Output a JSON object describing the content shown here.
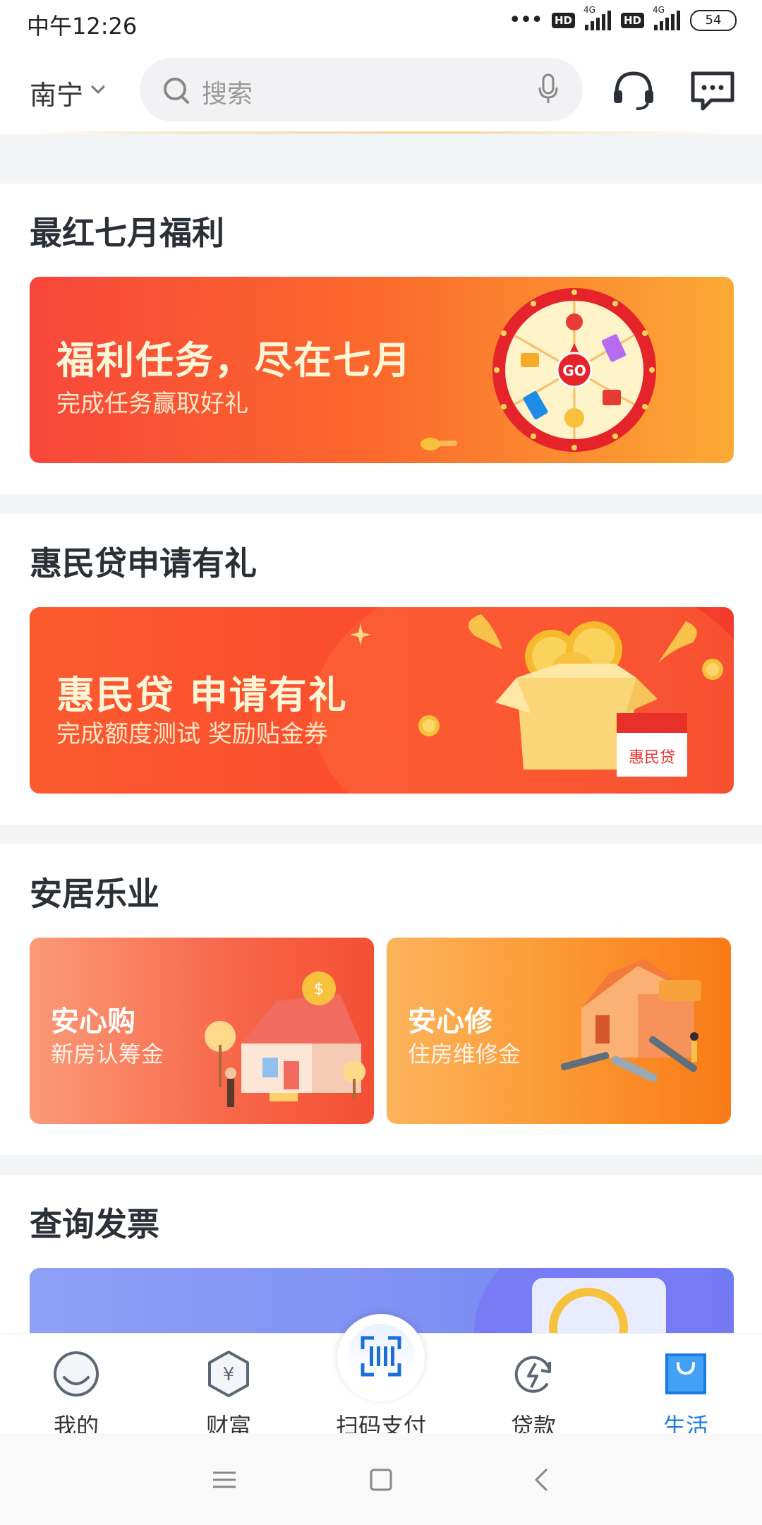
{
  "status_bar": {
    "time": "中午12:26",
    "hd1": "HD",
    "hd2": "HD",
    "net1": "4G",
    "net2": "4G",
    "battery": "54"
  },
  "header": {
    "city": "南宁",
    "search_placeholder": "搜索"
  },
  "sections": [
    {
      "title": "最红七月福利",
      "banner_title": "福利任务，尽在七月",
      "banner_sub": "完成任务赢取好礼",
      "wheel_label": "GO"
    },
    {
      "title": "惠民贷申请有礼",
      "banner_title": "惠民贷 申请有礼",
      "banner_sub": "完成额度测试 奖励贴金券",
      "box_label": "惠民贷"
    },
    {
      "title": "安居乐业",
      "cards": [
        {
          "title": "安心购",
          "sub": "新房认筹金"
        },
        {
          "title": "安心修",
          "sub": "住房维修金"
        }
      ]
    },
    {
      "title": "查询发票"
    }
  ],
  "bottom_nav": [
    {
      "label": "我的",
      "icon": "profile-icon"
    },
    {
      "label": "财富",
      "icon": "wealth-icon"
    },
    {
      "label": "扫码支付",
      "icon": "scan-icon"
    },
    {
      "label": "贷款",
      "icon": "loan-icon"
    },
    {
      "label": "生活",
      "icon": "life-icon",
      "active": true
    }
  ],
  "colors": {
    "accent": "#1a7be0",
    "red": "#f8463a",
    "orange": "#fb9631"
  }
}
